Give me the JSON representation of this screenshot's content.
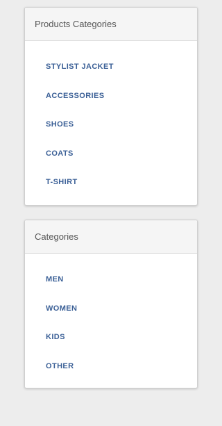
{
  "colors": {
    "page_background": "#ededed",
    "link": "#3a5f96",
    "heading_text": "#555555"
  },
  "products_panel": {
    "title": "Products Categories",
    "items": [
      {
        "label": "STYLIST JACKET"
      },
      {
        "label": "ACCESSORIES"
      },
      {
        "label": "SHOES"
      },
      {
        "label": "COATS"
      },
      {
        "label": "T-SHIRT"
      }
    ]
  },
  "categories_panel": {
    "title": "Categories",
    "items": [
      {
        "label": "MEN"
      },
      {
        "label": "WOMEN"
      },
      {
        "label": "KIDS"
      },
      {
        "label": "OTHER"
      }
    ]
  }
}
